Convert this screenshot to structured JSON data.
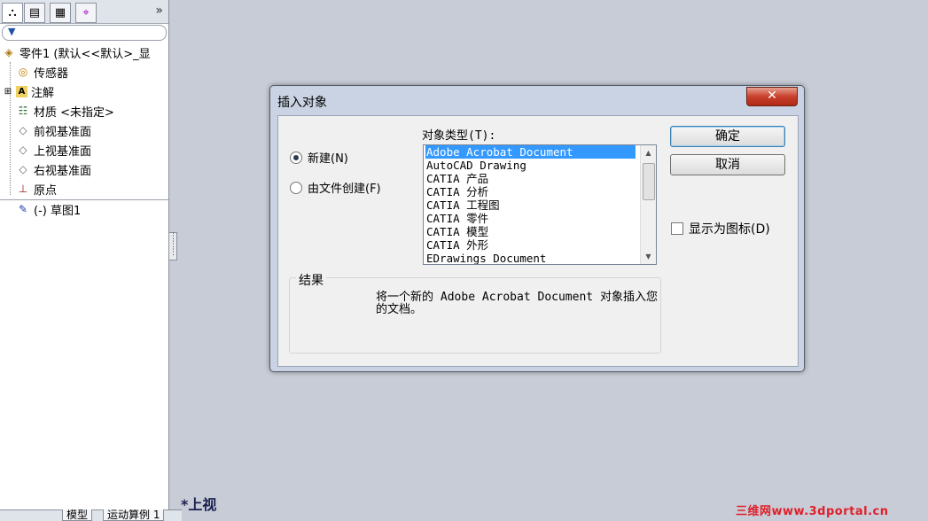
{
  "tree": {
    "root": "零件1 (默认<<默认>_显",
    "items": [
      {
        "label": "传感器",
        "icon": "sensor-icon"
      },
      {
        "label": "注解",
        "icon": "annotation-icon"
      },
      {
        "label": "材质 <未指定>",
        "icon": "material-icon"
      },
      {
        "label": "前视基准面",
        "icon": "plane-icon"
      },
      {
        "label": "上视基准面",
        "icon": "plane-icon"
      },
      {
        "label": "右视基准面",
        "icon": "plane-icon"
      },
      {
        "label": "原点",
        "icon": "origin-icon"
      },
      {
        "label": "(-) 草图1",
        "icon": "sketch-icon"
      }
    ]
  },
  "bottom_tabs": [
    "模型",
    "运动算例 1"
  ],
  "view_label": "*上视",
  "watermark": "三维网www.3dportal.cn",
  "dialog": {
    "title": "插入对象",
    "close": "✕",
    "radio_new": "新建(N)",
    "radio_file": "由文件创建(F)",
    "type_label": "对象类型(T):",
    "types": [
      "Adobe Acrobat Document",
      "AutoCAD Drawing",
      "CATIA 产品",
      "CATIA 分析",
      "CATIA 工程图",
      "CATIA 零件",
      "CATIA 模型",
      "CATIA 外形",
      "EDrawings Document"
    ],
    "selected_index": 0,
    "ok": "确定",
    "cancel": "取消",
    "display_as_icon": "显示为图标(D)",
    "result_title": "结果",
    "result_text": "将一个新的 Adobe Acrobat Document 对象插入您的文档。"
  },
  "colors": {
    "selection": "#3399ff",
    "close_button": "#c8402c"
  }
}
